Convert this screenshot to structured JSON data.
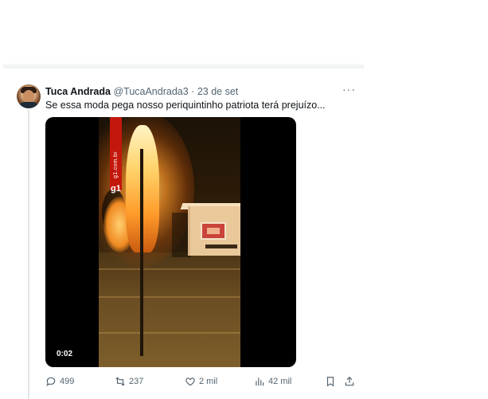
{
  "tweet": {
    "author_name": "Tuca Andrada",
    "handle": "@TucaAndrada3",
    "separator": "·",
    "date": "23 de set",
    "more_icon": "more-horizontal-icon",
    "text": "Se essa moda pega nosso periquintinho patriota terá prejuízo..."
  },
  "media": {
    "watermark_site": "g1.com.br",
    "watermark_logo": "g1",
    "duration": "0:02",
    "colors": {
      "g1_red": "#c4170c",
      "fire": "#ffb347"
    }
  },
  "actions": {
    "reply": {
      "icon": "reply-icon",
      "count": "499"
    },
    "retweet": {
      "icon": "retweet-icon",
      "count": "237"
    },
    "like": {
      "icon": "heart-icon",
      "count": "2 mil"
    },
    "views": {
      "icon": "views-bar-chart-icon",
      "count": "42 mil"
    },
    "bookmark": {
      "icon": "bookmark-icon"
    },
    "share": {
      "icon": "share-icon"
    }
  },
  "colors": {
    "text_primary": "#0f1419",
    "text_secondary": "#536471",
    "divider": "#eff3f4"
  }
}
